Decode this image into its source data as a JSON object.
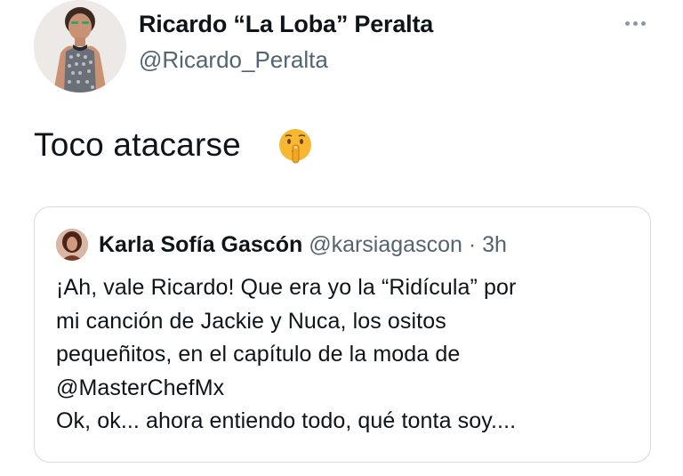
{
  "tweet": {
    "author": {
      "display_name": "Ricardo “La Loba” Peralta",
      "handle": "@Ricardo_Peralta"
    },
    "text": "Toco atacarse",
    "emoji": "shushing-face-emoji",
    "more_icon": "more-horizontal-icon"
  },
  "quote": {
    "author": {
      "display_name": "Karla Sofía Gascón",
      "handle": "@karsiagascon",
      "separator": "·",
      "time": "3h"
    },
    "lines": [
      "¡Ah, vale Ricardo! Que era yo la “Ridícula” por",
      "mi canción de Jackie y Nuca, los ositos",
      "pequeñitos, en el capítulo de la moda de",
      "@MasterChefMx",
      "Ok, ok... ahora entiendo todo, qué tonta soy...."
    ]
  },
  "colors": {
    "text_primary": "#0f1419",
    "text_secondary": "#536471",
    "border": "#d4dbe1",
    "emoji_yellow": "#f7b731"
  }
}
